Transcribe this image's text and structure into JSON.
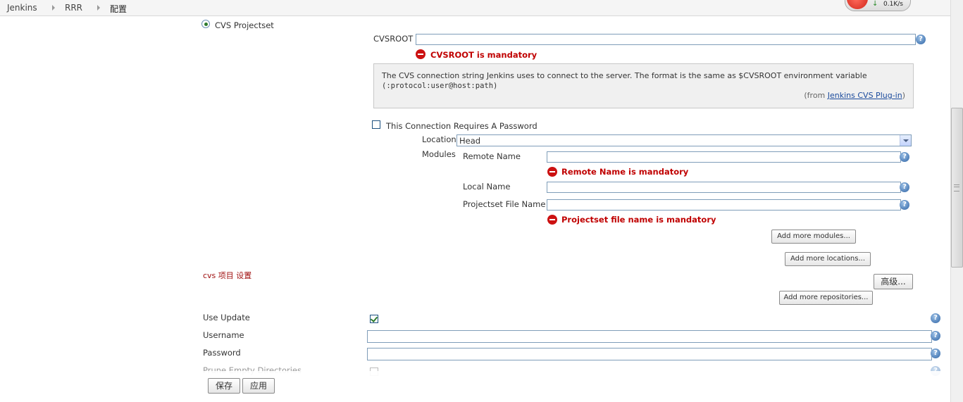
{
  "breadcrumb": [
    "Jenkins",
    "RRR",
    "配置"
  ],
  "speed_indicator": {
    "text": "0.1K/s",
    "arrow": "↓"
  },
  "scm": {
    "option_label": "CVS Projectset",
    "cvsroot_label": "CVSROOT",
    "cvsroot_value": "",
    "cvsroot_error": "CVSROOT is mandatory",
    "help_text_line1": "The CVS connection string Jenkins uses to connect to the server. The format is the same as $CVSROOT environment variable",
    "help_text_line2": "(:protocol:user@host:path)",
    "help_from_prefix": "(from ",
    "help_from_link": "Jenkins CVS Plug-in",
    "help_from_suffix": ")",
    "password_checkbox_label": "This Connection Requires A Password",
    "password_checkbox_checked": false,
    "location_label": "Location",
    "location_value": "Head",
    "modules_label": "Modules",
    "remote_name_label": "Remote Name",
    "remote_name_error": "Remote Name is mandatory",
    "local_name_label": "Local Name",
    "projectset_label": "Projectset File Name",
    "projectset_error": "Projectset file name is mandatory",
    "add_modules_button": "Add more modules...",
    "add_locations_button": "Add more locations...",
    "section_title": "cvs 项目 设置",
    "advanced_button": "高级...",
    "add_repositories_button": "Add more repositories...",
    "use_update_label": "Use Update",
    "use_update_checked": true,
    "username_label": "Username",
    "password_label": "Password",
    "prune_label": "Prune Empty Directories"
  },
  "footer": {
    "save_button": "保存",
    "apply_button": "应用"
  },
  "colors": {
    "error": "#c00000",
    "link": "#1a4a9c",
    "help_icon": "#2f64a5"
  }
}
